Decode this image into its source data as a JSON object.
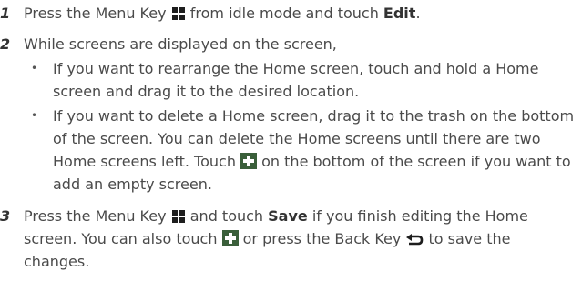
{
  "steps": [
    {
      "number": "1",
      "parts": [
        "Press the Menu Key ",
        " from idle mode and touch ",
        "Edit",
        "."
      ]
    },
    {
      "number": "2",
      "intro": "While screens are displayed on the screen,",
      "bullets": [
        "If you want to rearrange the Home screen, touch and hold a Home screen and drag it to the desired location.",
        [
          "If you want to delete a Home screen, drag it to the trash on the bottom of the screen. You can delete the Home screens until there are two Home screens left. Touch ",
          " on the bottom of the screen if you want to add an empty screen."
        ]
      ]
    },
    {
      "number": "3",
      "parts": [
        "Press the Menu Key ",
        " and touch ",
        "Save",
        " if you finish editing the Home screen. You can also touch ",
        " or press the Back Key ",
        " to save the changes."
      ]
    }
  ],
  "bullet_char": "•",
  "icons": {
    "menu_key": "menu-key-icon",
    "plus": "add-screen-icon",
    "back_key": "back-key-icon"
  },
  "colors": {
    "text": "#4a4a4a",
    "icon_dark": "#1e1e1e",
    "plus_bg": "#3a5f3a",
    "plus_fg": "#ffffff"
  }
}
